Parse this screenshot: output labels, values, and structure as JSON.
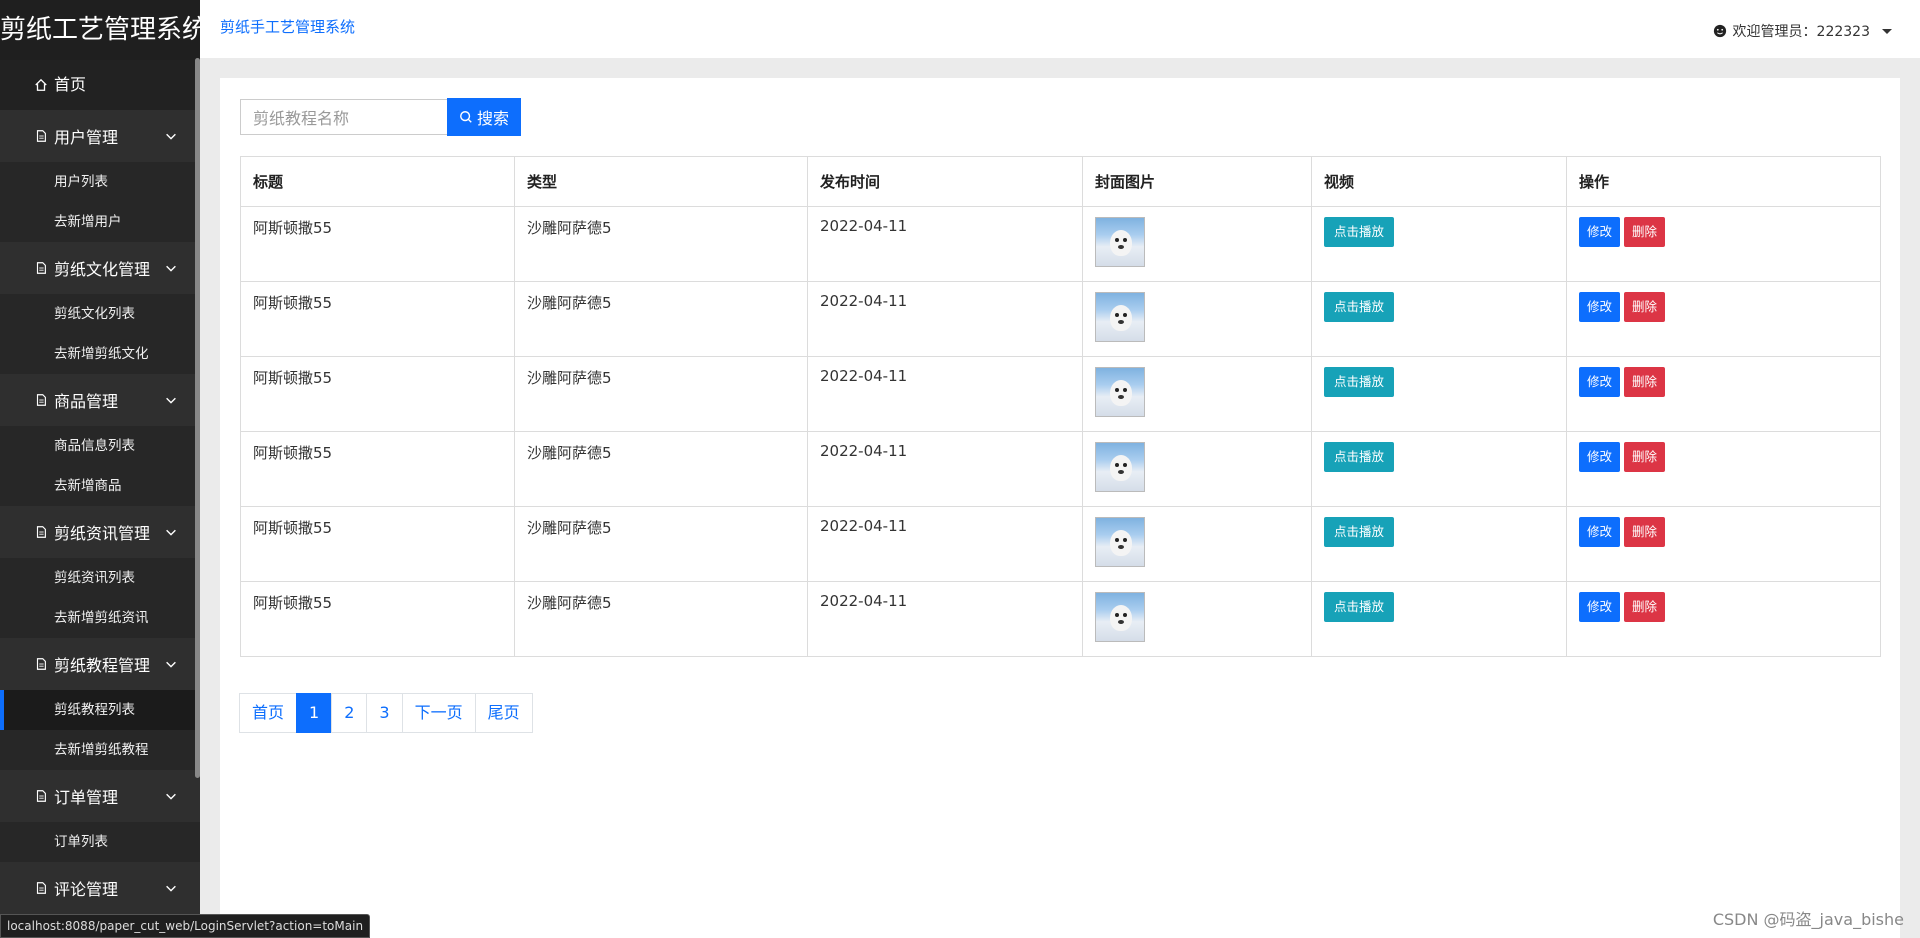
{
  "brand": "剪纸工艺管理系统",
  "sidebar": {
    "home": "首页",
    "groups": [
      {
        "label": "用户管理",
        "items": [
          "用户列表",
          "去新增用户"
        ]
      },
      {
        "label": "剪纸文化管理",
        "items": [
          "剪纸文化列表",
          "去新增剪纸文化"
        ]
      },
      {
        "label": "商品管理",
        "items": [
          "商品信息列表",
          "去新增商品"
        ]
      },
      {
        "label": "剪纸资讯管理",
        "items": [
          "剪纸资讯列表",
          "去新增剪纸资讯"
        ]
      },
      {
        "label": "剪纸教程管理",
        "items": [
          "剪纸教程列表",
          "去新增剪纸教程"
        ]
      },
      {
        "label": "订单管理",
        "items": [
          "订单列表"
        ]
      },
      {
        "label": "评论管理",
        "items": []
      }
    ]
  },
  "header": {
    "breadcrumb": "剪纸手工艺管理系统",
    "user": "欢迎管理员：222323"
  },
  "search": {
    "placeholder": "剪纸教程名称",
    "button": "搜索"
  },
  "table": {
    "columns": [
      "标题",
      "类型",
      "发布时间",
      "封面图片",
      "视频",
      "操作"
    ],
    "rows": [
      {
        "title": "阿斯顿撒55",
        "type": "沙雕阿萨德5",
        "date": "2022-04-11"
      },
      {
        "title": "阿斯顿撒55",
        "type": "沙雕阿萨德5",
        "date": "2022-04-11"
      },
      {
        "title": "阿斯顿撒55",
        "type": "沙雕阿萨德5",
        "date": "2022-04-11"
      },
      {
        "title": "阿斯顿撒55",
        "type": "沙雕阿萨德5",
        "date": "2022-04-11"
      },
      {
        "title": "阿斯顿撒55",
        "type": "沙雕阿萨德5",
        "date": "2022-04-11"
      },
      {
        "title": "阿斯顿撒55",
        "type": "沙雕阿萨德5",
        "date": "2022-04-11"
      }
    ],
    "play_label": "点击播放",
    "edit_label": "修改",
    "delete_label": "删除"
  },
  "pager": {
    "first": "首页",
    "pages": [
      "1",
      "2",
      "3"
    ],
    "current": "1",
    "next": "下一页",
    "last": "尾页"
  },
  "status_url": "localhost:8088/paper_cut_web/LoginServlet?action=toMain",
  "watermark": "CSDN @码盗_java_bishe",
  "colors": {
    "accent": "#0d6efd",
    "danger": "#dc3545",
    "info": "#17a2b8",
    "sidebar": "#2f2f2f"
  }
}
